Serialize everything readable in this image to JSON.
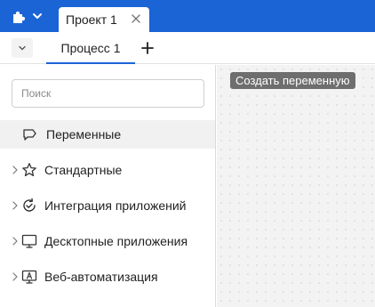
{
  "header": {
    "app_menu_icon": "puzzle-icon",
    "document_tab": {
      "label": "Проект 1",
      "close_icon": "close-icon"
    }
  },
  "subbar": {
    "collapse_icon": "chevron-down-icon",
    "process_tab": {
      "label": "Процесс 1"
    },
    "add_tab_icon": "plus-icon"
  },
  "sidebar": {
    "search": {
      "placeholder": "Поиск",
      "value": ""
    },
    "items": [
      {
        "label": "Переменные",
        "icon": "variable-icon",
        "expandable": false,
        "selected": true
      },
      {
        "label": "Стандартные",
        "icon": "star-icon",
        "expandable": true,
        "selected": false
      },
      {
        "label": "Интеграция приложений",
        "icon": "sync-check-icon",
        "expandable": true,
        "selected": false
      },
      {
        "label": "Десктопные приложения",
        "icon": "monitor-icon",
        "expandable": true,
        "selected": false
      },
      {
        "label": "Веб-автоматизация",
        "icon": "web-automation-icon",
        "expandable": true,
        "selected": false
      }
    ]
  },
  "canvas": {
    "tooltip": "Создать переменную"
  },
  "colors": {
    "accent": "#1a64d6",
    "tooltip_bg": "#6e6e6e",
    "selected_row_bg": "#f1f1f1",
    "canvas_bg": "#f3f3f3"
  }
}
